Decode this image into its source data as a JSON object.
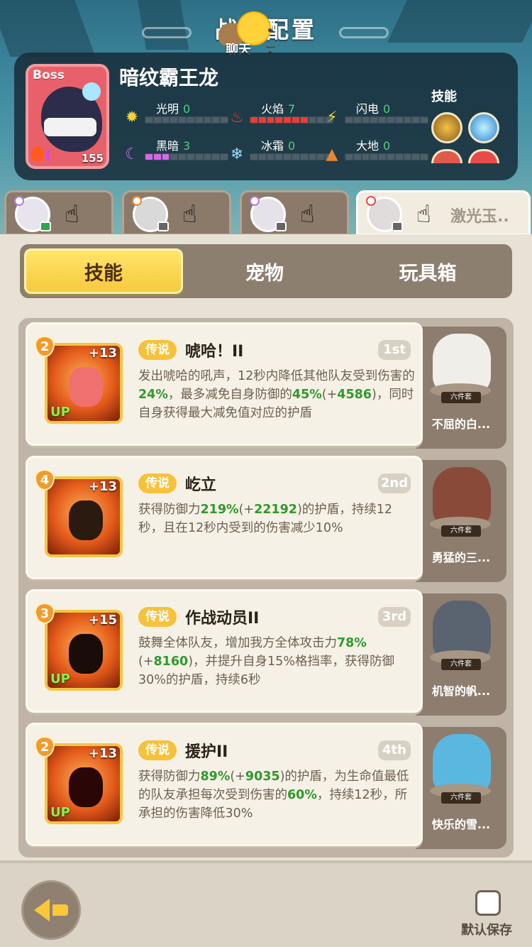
{
  "header": {
    "title": "战斗配置",
    "chat_label": "聊天"
  },
  "boss": {
    "tag": "Boss",
    "name": "暗纹霸王龙",
    "level": "155",
    "elements": [
      {
        "name": "光明",
        "value": "0",
        "filled": 0,
        "icon": "sun-icon",
        "color": "#f5d13a"
      },
      {
        "name": "火焰",
        "value": "7",
        "filled": 7,
        "icon": "fire-icon",
        "color": "#ef3b34"
      },
      {
        "name": "闪电",
        "value": "0",
        "filled": 0,
        "icon": "lightning-icon",
        "color": "#f5d13a"
      },
      {
        "name": "黑暗",
        "value": "3",
        "filled": 3,
        "icon": "moon-icon",
        "color": "#d469e8"
      },
      {
        "name": "冰霜",
        "value": "0",
        "filled": 0,
        "icon": "snowflake-icon",
        "color": "#9fdcff"
      },
      {
        "name": "大地",
        "value": "0",
        "filled": 0,
        "icon": "earth-icon",
        "color": "#e8862e"
      }
    ],
    "skills_label": "技能"
  },
  "hero_tabs": [
    {
      "name": "",
      "active": false
    },
    {
      "name": "",
      "active": false
    },
    {
      "name": "",
      "active": false
    },
    {
      "name": "激光玉..",
      "active": true
    }
  ],
  "segments": {
    "skills": "技能",
    "pets": "宠物",
    "toybox": "玩具箱"
  },
  "skills": [
    {
      "level": "2",
      "plus": "+13",
      "up": "UP",
      "rarity": "传说",
      "title": "唬哈！II",
      "rank": "1st",
      "desc_parts": [
        "发出唬哈的吼声，12秒内降低其他队友受到伤害的",
        "24%",
        "，最多减免自身防御的",
        "45%",
        "(+",
        "4586",
        ")，同时自身获得最大减免值对应的护盾"
      ],
      "pet_name": "不屈的白...",
      "pet_set": "六件套"
    },
    {
      "level": "4",
      "plus": "+13",
      "up": "",
      "rarity": "传说",
      "title": "屹立",
      "rank": "2nd",
      "desc_parts": [
        "获得防御力",
        "219%",
        "(+",
        "22192",
        ")的护盾，持续12秒，且在12秒内受到的伤害减少10%",
        "",
        ""
      ],
      "pet_name": "勇猛的三...",
      "pet_set": "六件套"
    },
    {
      "level": "3",
      "plus": "+15",
      "up": "UP",
      "rarity": "传说",
      "title": "作战动员II",
      "rank": "3rd",
      "desc_parts": [
        "鼓舞全体队友，增加我方全体攻击力",
        "78%",
        "(+",
        "8160",
        ")，并提升自身15%格挡率，获得防御30%的护盾，持续6秒",
        "",
        ""
      ],
      "pet_name": "机智的帆...",
      "pet_set": "六件套"
    },
    {
      "level": "2",
      "plus": "+13",
      "up": "UP",
      "rarity": "传说",
      "title": "援护II",
      "rank": "4th",
      "desc_parts": [
        "获得防御力",
        "89%",
        "(+",
        "9035",
        ")的护盾，为生命值最低的队友承担每次受到伤害的",
        "60%",
        "，持续12秒，所承担的伤害降低30%"
      ],
      "pet_name": "快乐的雪...",
      "pet_set": "六件套"
    }
  ],
  "bottom": {
    "save_label": "默认保存"
  }
}
